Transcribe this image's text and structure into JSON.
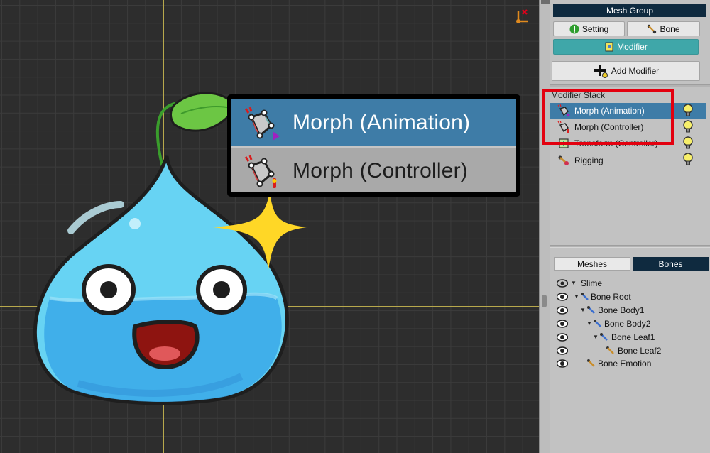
{
  "panel": {
    "title": "Mesh Group",
    "buttons": {
      "setting": "Setting",
      "bone": "Bone",
      "modifier": "Modifier",
      "add_modifier": "Add Modifier"
    },
    "modifier_stack": {
      "header": "Modifier Stack",
      "items": [
        {
          "label": "Morph (Animation)",
          "selected": true
        },
        {
          "label": "Morph (Controller)",
          "selected": false
        },
        {
          "label": "Transform (Controller)",
          "selected": false
        },
        {
          "label": "Rigging",
          "selected": false
        }
      ]
    },
    "tabs": {
      "meshes": "Meshes",
      "bones": "Bones",
      "active": "Bones"
    },
    "bone_tree": [
      {
        "label": "Slime"
      },
      {
        "label": "Bone Root"
      },
      {
        "label": "Bone Body1"
      },
      {
        "label": "Bone Body2"
      },
      {
        "label": "Bone Leaf1"
      },
      {
        "label": "Bone Leaf2"
      },
      {
        "label": "Bone Emotion"
      }
    ]
  },
  "zoom_callout": {
    "items": [
      {
        "label": "Morph (Animation)",
        "selected": true
      },
      {
        "label": "Morph (Controller)",
        "selected": false
      }
    ]
  },
  "colors": {
    "selection_blue": "#3e7ca7",
    "header_navy": "#0f2a3f",
    "modifier_teal": "#3fa7a9",
    "highlight_red": "#e3000f",
    "axis_yellow": "#b7a84c"
  },
  "icons": [
    "gizmo-icon",
    "setting-icon",
    "bone-icon",
    "modifier-icon",
    "add-modifier-icon",
    "morph-animation-icon",
    "morph-controller-icon",
    "transform-icon",
    "rigging-icon",
    "lightbulb-icon",
    "eye-icon",
    "collapse-arrow-icon"
  ]
}
